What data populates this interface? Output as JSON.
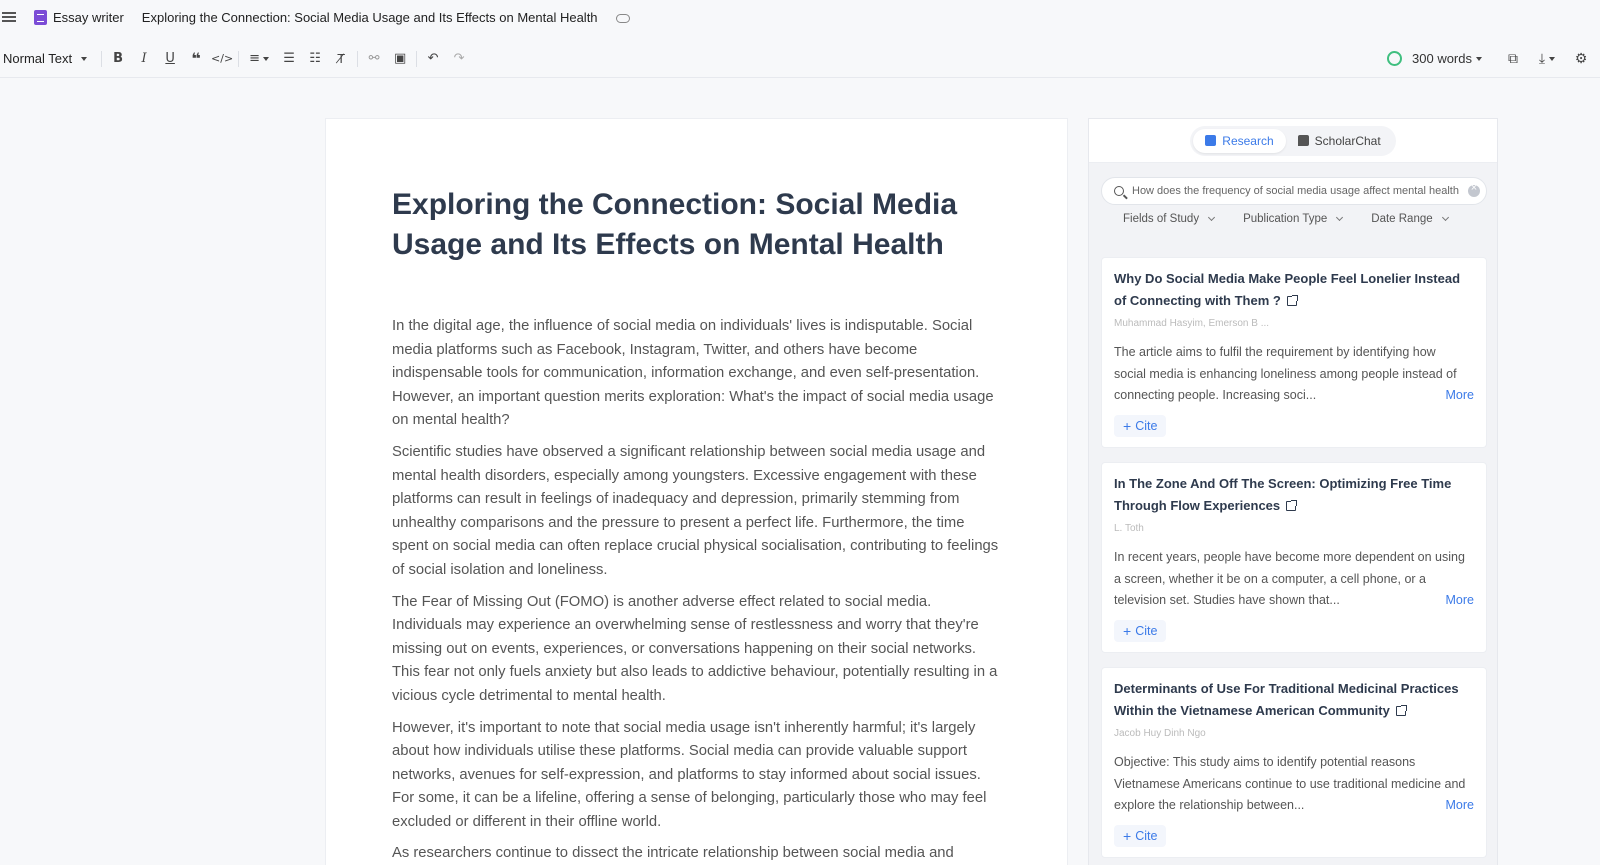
{
  "topbar": {
    "app_name": "Essay writer",
    "document_title": "Exploring the Connection: Social Media Usage and Its Effects on Mental Health"
  },
  "toolbar": {
    "text_style": "Normal Text",
    "word_count": "300 words",
    "buttons": [
      "bold-icon",
      "italic-icon",
      "underline-icon",
      "quote-icon",
      "code-icon",
      "align-icon",
      "ordered-list-icon",
      "bullet-list-icon",
      "clear-format-icon",
      "link-icon",
      "image-icon",
      "undo-icon",
      "redo-icon"
    ]
  },
  "editor": {
    "title": "Exploring the Connection: Social Media Usage and Its Effects on Mental Health",
    "paragraphs": [
      "In the digital age, the influence of social media on individuals' lives is indisputable. Social media platforms such as Facebook, Instagram, Twitter, and others have become indispensable tools for communication, information exchange, and even self-presentation. However, an important question merits exploration: What's the impact of social media usage on mental health?",
      "Scientific studies have observed a significant relationship between social media usage and mental health disorders, especially among youngsters. Excessive engagement with these platforms can result in feelings of inadequacy and depression, primarily stemming from unhealthy comparisons and the pressure to present a perfect life. Furthermore, the time spent on social media can often replace crucial physical socialisation, contributing to feelings of social isolation and loneliness.",
      "The Fear of Missing Out (FOMO) is another adverse effect related to social media. Individuals may experience an overwhelming sense of restlessness and worry that they're missing out on events, experiences, or conversations happening on their social networks. This fear not only fuels anxiety but also leads to addictive behaviour, potentially resulting in a vicious cycle detrimental to mental health.",
      "However, it's important to note that social media usage isn't inherently harmful; it's largely about how individuals utilise these platforms. Social media can provide valuable support networks, avenues for self-expression, and platforms to stay informed about social issues. For some, it can be a lifeline, offering a sense of belonging, particularly those who may feel excluded or different in their offline world.",
      "As researchers continue to dissect the intricate relationship between social media and"
    ]
  },
  "panel": {
    "tabs": [
      {
        "label": "Research",
        "active": true
      },
      {
        "label": "ScholarChat",
        "active": false
      }
    ],
    "search": {
      "value": "How does the frequency of social media usage affect mental health"
    },
    "filters": [
      "Fields of Study",
      "Publication Type",
      "Date Range"
    ],
    "results": [
      {
        "title": "Why Do Social Media Make People Feel Lonelier Instead of Connecting with Them ?",
        "authors": "Muhammad Hasyim, Emerson B ...",
        "abstract": "The article aims to fulfil the requirement by identifying how social media is enhancing loneliness among people instead of connecting people. Increasing soci...",
        "more_label": "More",
        "cite_label": "Cite"
      },
      {
        "title": "In The Zone And Off The Screen: Optimizing Free Time Through Flow Experiences",
        "authors": "L. Toth",
        "abstract": "In recent years, people have become more dependent on using a screen, whether it be on a computer, a cell phone, or a television set. Studies have shown that...",
        "more_label": "More",
        "cite_label": "Cite"
      },
      {
        "title": "Determinants of Use For Traditional Medicinal Practices Within the Vietnamese American Community",
        "authors": "Jacob Huy Dinh Ngo",
        "abstract": "Objective: This study aims to identify potential reasons Vietnamese Americans continue to use traditional medicine and explore the relationship between...",
        "more_label": "More",
        "cite_label": "Cite"
      }
    ]
  },
  "colors": {
    "accent": "#3b7ae8",
    "title": "#2e3a4d",
    "logo": "#7b4cd6",
    "timer": "#3fbf7f"
  }
}
